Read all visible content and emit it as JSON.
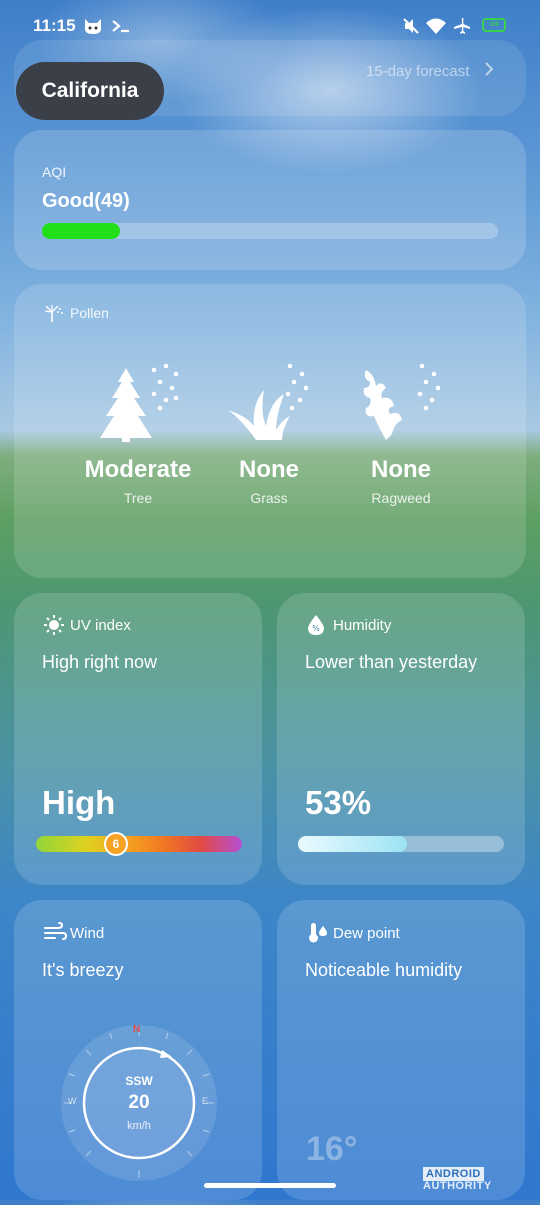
{
  "status_bar": {
    "time": "11:15",
    "battery": "100",
    "icons": [
      "cat-app-icon",
      "terminal-icon",
      "mute-icon",
      "wifi-icon",
      "airplane-icon",
      "battery-icon"
    ]
  },
  "header": {
    "location": "California",
    "forecast_link": "15-day forecast"
  },
  "aqi": {
    "label": "AQI",
    "value": "Good(49)",
    "level_fraction": 0.17,
    "color": "#21e01a"
  },
  "pollen": {
    "label": "Pollen",
    "items": [
      {
        "level": "Moderate",
        "name": "Tree",
        "icon": "tree-pollen-icon"
      },
      {
        "level": "None",
        "name": "Grass",
        "icon": "grass-pollen-icon"
      },
      {
        "level": "None",
        "name": "Ragweed",
        "icon": "ragweed-pollen-icon"
      }
    ]
  },
  "uv": {
    "label": "UV index",
    "description": "High right now",
    "value": "High",
    "index": "6",
    "index_fraction": 0.39
  },
  "humidity": {
    "label": "Humidity",
    "description": "Lower than yesterday",
    "value": "53%",
    "fraction": 0.53
  },
  "wind": {
    "label": "Wind",
    "description": "It's breezy",
    "direction": "SSW",
    "speed": "20",
    "unit": "km/h",
    "compass": {
      "n": "N",
      "e": "E",
      "w": "W"
    }
  },
  "dew_point": {
    "label": "Dew point",
    "description": "Noticeable humidity",
    "value": "16°"
  },
  "watermark": {
    "brand_box": "ANDROID",
    "brand_rest": "AUTHORITY"
  },
  "colors": {
    "accent_green": "#21e01a",
    "pill_bg": "#3b3f47",
    "uv_marker": "#f5a223"
  }
}
